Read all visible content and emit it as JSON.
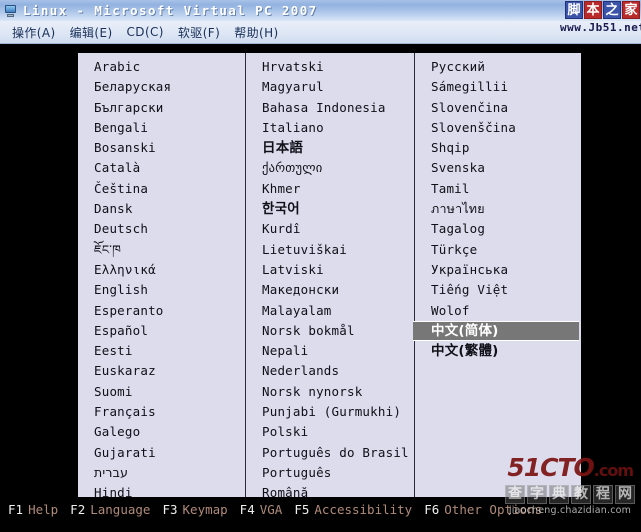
{
  "window": {
    "title": "Linux - Microsoft Virtual PC 2007",
    "icon": "virtual-pc-icon"
  },
  "menubar": {
    "items": [
      {
        "label": "操作(A)"
      },
      {
        "label": "编辑(E)"
      },
      {
        "label": "CD(C)"
      },
      {
        "label": "软驱(F)"
      },
      {
        "label": "帮助(H)"
      }
    ]
  },
  "watermark_top": {
    "chars": [
      "脚",
      "本",
      "之",
      "家"
    ],
    "url": "www.Jb51.net"
  },
  "watermark_bottom": {
    "brand": "51CTO",
    "domain": ".com",
    "chars": [
      "查",
      "字",
      "典",
      "教",
      "程",
      "网"
    ],
    "site": "jiaocheng.chazidian.com"
  },
  "language_list": {
    "selected": "中文(简体)",
    "columns": [
      {
        "items": [
          {
            "label": "Arabic",
            "style": "mono"
          },
          {
            "label": "Беларуская",
            "style": "mono"
          },
          {
            "label": "Български",
            "style": "mono"
          },
          {
            "label": "Bengali",
            "style": "mono"
          },
          {
            "label": "Bosanski",
            "style": "mono"
          },
          {
            "label": "Català",
            "style": "mono"
          },
          {
            "label": "Čeština",
            "style": "mono"
          },
          {
            "label": "Dansk",
            "style": "mono"
          },
          {
            "label": "Deutsch",
            "style": "mono"
          },
          {
            "label": "ཇོང་ཁ",
            "style": "script"
          },
          {
            "label": "Ελληνικά",
            "style": "mono"
          },
          {
            "label": "English",
            "style": "mono"
          },
          {
            "label": "Esperanto",
            "style": "mono"
          },
          {
            "label": "Español",
            "style": "mono"
          },
          {
            "label": "Eesti",
            "style": "mono"
          },
          {
            "label": "Euskaraz",
            "style": "mono"
          },
          {
            "label": "Suomi",
            "style": "mono"
          },
          {
            "label": "Français",
            "style": "mono"
          },
          {
            "label": "Galego",
            "style": "mono"
          },
          {
            "label": "Gujarati",
            "style": "mono"
          },
          {
            "label": "עברית",
            "style": "script"
          },
          {
            "label": "Hindi",
            "style": "mono"
          }
        ]
      },
      {
        "items": [
          {
            "label": "Hrvatski",
            "style": "mono"
          },
          {
            "label": "Magyarul",
            "style": "mono"
          },
          {
            "label": "Bahasa Indonesia",
            "style": "mono"
          },
          {
            "label": "Italiano",
            "style": "mono"
          },
          {
            "label": "日本語",
            "style": "cjk"
          },
          {
            "label": "ქართული",
            "style": "script"
          },
          {
            "label": "Khmer",
            "style": "mono"
          },
          {
            "label": "한국어",
            "style": "cjk"
          },
          {
            "label": "Kurdî",
            "style": "mono"
          },
          {
            "label": "Lietuviškai",
            "style": "mono"
          },
          {
            "label": "Latviski",
            "style": "mono"
          },
          {
            "label": "Македонски",
            "style": "mono"
          },
          {
            "label": "Malayalam",
            "style": "mono"
          },
          {
            "label": "Norsk bokmål",
            "style": "mono"
          },
          {
            "label": "Nepali",
            "style": "mono"
          },
          {
            "label": "Nederlands",
            "style": "mono"
          },
          {
            "label": "Norsk nynorsk",
            "style": "mono"
          },
          {
            "label": "Punjabi (Gurmukhi)",
            "style": "mono"
          },
          {
            "label": "Polski",
            "style": "mono"
          },
          {
            "label": "Português do Brasil",
            "style": "mono"
          },
          {
            "label": "Português",
            "style": "mono"
          },
          {
            "label": "Română",
            "style": "mono"
          }
        ]
      },
      {
        "items": [
          {
            "label": "Русский",
            "style": "mono"
          },
          {
            "label": "Sámegillii",
            "style": "mono"
          },
          {
            "label": "Slovenčina",
            "style": "mono"
          },
          {
            "label": "Slovenščina",
            "style": "mono"
          },
          {
            "label": "Shqip",
            "style": "mono"
          },
          {
            "label": "Svenska",
            "style": "mono"
          },
          {
            "label": "Tamil",
            "style": "mono"
          },
          {
            "label": "ภาษาไทย",
            "style": "script"
          },
          {
            "label": "Tagalog",
            "style": "mono"
          },
          {
            "label": "Türkçe",
            "style": "mono"
          },
          {
            "label": "Українська",
            "style": "mono"
          },
          {
            "label": "Tiếng Việt",
            "style": "mono"
          },
          {
            "label": "Wolof",
            "style": "mono"
          },
          {
            "label": "中文(简体)",
            "style": "cjk",
            "selected": true
          },
          {
            "label": "中文(繁體)",
            "style": "cjk"
          }
        ]
      }
    ]
  },
  "function_keys": [
    {
      "key": "F1",
      "label": "Help"
    },
    {
      "key": "F2",
      "label": "Language"
    },
    {
      "key": "F3",
      "label": "Keymap"
    },
    {
      "key": "F4",
      "label": "VGA"
    },
    {
      "key": "F5",
      "label": "Accessibility"
    },
    {
      "key": "F6",
      "label": "Other Options"
    }
  ]
}
